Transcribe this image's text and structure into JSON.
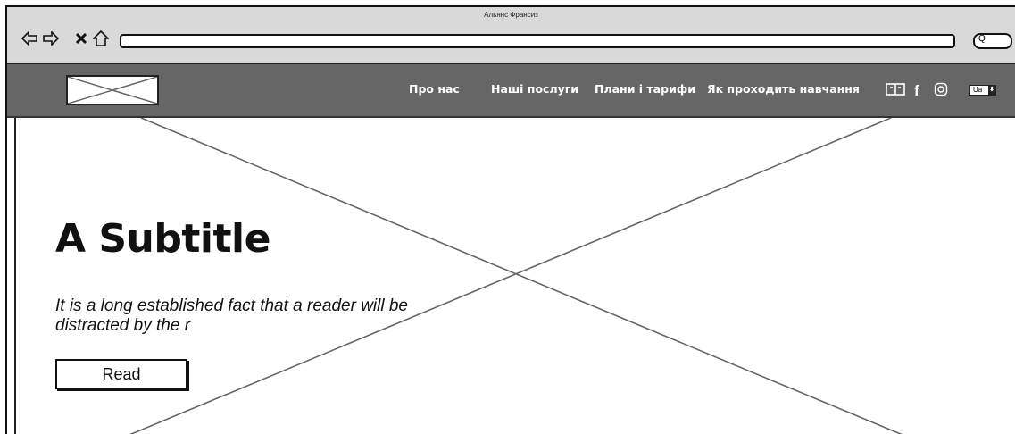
{
  "window": {
    "title": "Альянс Франсиз"
  },
  "browser": {
    "back_icon": "back-arrow-icon",
    "forward_icon": "forward-arrow-icon",
    "close_icon": "close-icon",
    "home_icon": "home-icon",
    "search_glyph": "Q"
  },
  "header": {
    "nav": [
      "Про нас",
      "Наші послуги",
      "Плани і тарифи",
      "Як проходить навчання"
    ],
    "language": "Ua",
    "icons": [
      "book-icon",
      "facebook-icon",
      "instagram-icon"
    ]
  },
  "hero": {
    "subtitle": "A Subtitle",
    "text": "It is a long established fact that a reader will be distracted by the r",
    "button": "Read"
  }
}
